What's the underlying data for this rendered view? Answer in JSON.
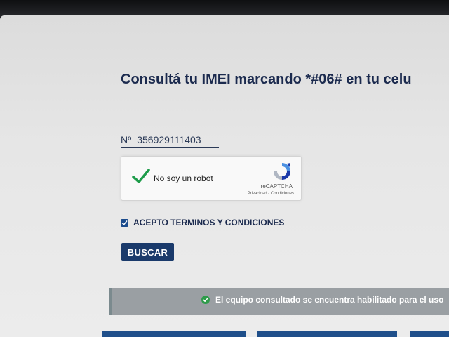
{
  "header": {
    "title": "Consultá tu IMEI marcando *#06# en tu celu"
  },
  "imei": {
    "prefix": "Nº",
    "value": "356929111403"
  },
  "recaptcha": {
    "label": "No soy un robot",
    "brand": "reCAPTCHA",
    "links": "Privacidad - Condiciones",
    "checked": true
  },
  "terms": {
    "label": "ACEPTO TERMINOS Y CONDICIONES",
    "checked": true
  },
  "actions": {
    "search_label": "BUSCAR"
  },
  "result": {
    "message": "El equipo consultado se encuentra habilitado para el uso",
    "status_color": "#2e9c4a"
  },
  "colors": {
    "primary": "#1a3a6b",
    "title": "#1b2a4e",
    "result_bg": "#9a9fa3"
  }
}
